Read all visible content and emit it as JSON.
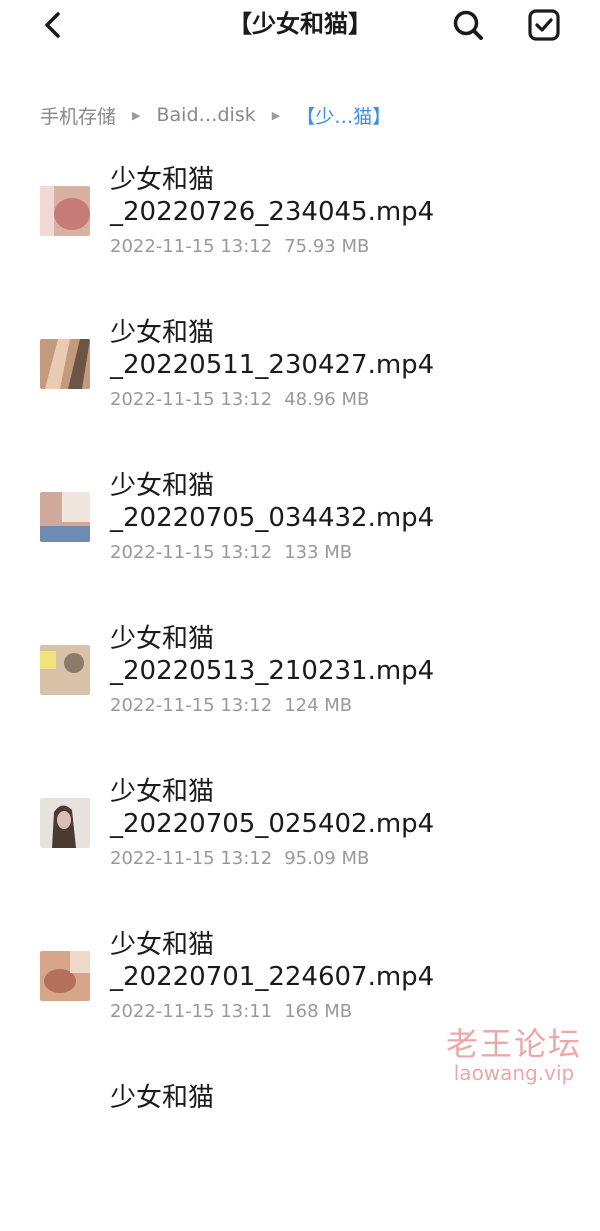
{
  "header": {
    "title": "【少女和猫】",
    "back_icon": "chevron-left-icon",
    "search_icon": "search-icon",
    "select_icon": "checkbox-icon"
  },
  "breadcrumb": {
    "items": [
      {
        "label": "手机存储"
      },
      {
        "label": "Baid…disk"
      },
      {
        "label": "【少…猫】"
      }
    ]
  },
  "files": [
    {
      "name_line1": "少女和猫",
      "name_line2": "_20220726_234045.mp4",
      "date": "2022-11-15 13:12",
      "size": "75.93 MB",
      "thumb_colors": [
        "#d9b1a3",
        "#c77a78",
        "#f0d9d2"
      ]
    },
    {
      "name_line1": "少女和猫",
      "name_line2": "_20220511_230427.mp4",
      "date": "2022-11-15 13:12",
      "size": "48.96 MB",
      "thumb_colors": [
        "#c29a7e",
        "#e9cbb4",
        "#6e5446"
      ]
    },
    {
      "name_line1": "少女和猫",
      "name_line2": "_20220705_034432.mp4",
      "date": "2022-11-15 13:12",
      "size": "133 MB",
      "thumb_colors": [
        "#cfa99a",
        "#efe6df",
        "#6d8bb3"
      ]
    },
    {
      "name_line1": "少女和猫",
      "name_line2": "_20220513_210231.mp4",
      "date": "2022-11-15 13:12",
      "size": "124 MB",
      "thumb_colors": [
        "#d8c3a8",
        "#f1e27a",
        "#8c7a6a"
      ]
    },
    {
      "name_line1": "少女和猫",
      "name_line2": "_20220705_025402.mp4",
      "date": "2022-11-15 13:12",
      "size": "95.09 MB",
      "thumb_colors": [
        "#e8e2dc",
        "#4a3a33",
        "#d8bfb2"
      ]
    },
    {
      "name_line1": "少女和猫",
      "name_line2": "_20220701_224607.mp4",
      "date": "2022-11-15 13:11",
      "size": "168 MB",
      "thumb_colors": [
        "#d6a58a",
        "#b4705a",
        "#efd9c9"
      ]
    },
    {
      "name_line1": "少女和猫",
      "name_line2": "",
      "date": "",
      "size": "",
      "thumb_colors": [
        "#d7b8a6",
        "#c48a76",
        "#efdcd0"
      ]
    }
  ],
  "watermark": {
    "cn": "老王论坛",
    "en": "laowang.vip"
  }
}
